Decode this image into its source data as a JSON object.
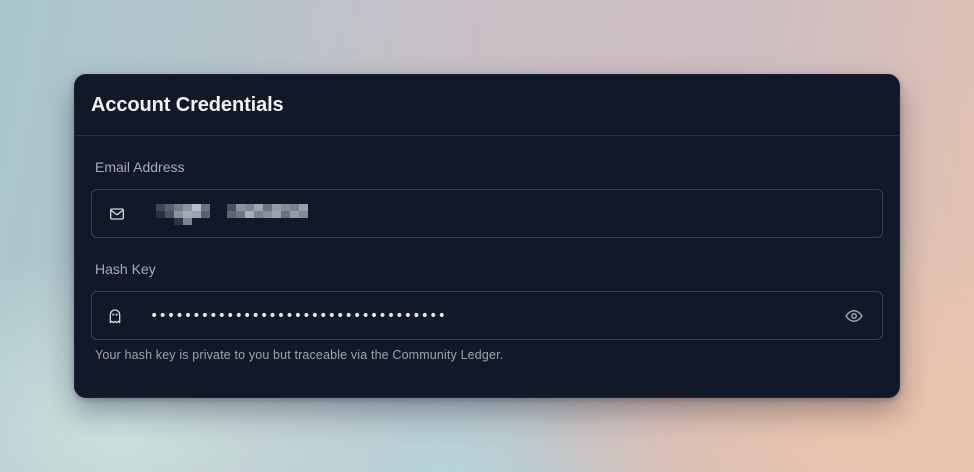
{
  "card": {
    "title": "Account Credentials"
  },
  "email": {
    "label": "Email Address",
    "value_obscured": true,
    "icon": "mail-icon"
  },
  "hash_key": {
    "label": "Hash Key",
    "value_masked": "•••••••••••••••••••••••••••••••••••",
    "icon": "ghost-icon",
    "toggle_icon": "eye-icon",
    "help_text": "Your hash key is private to you but traceable via the Community Ledger."
  }
}
